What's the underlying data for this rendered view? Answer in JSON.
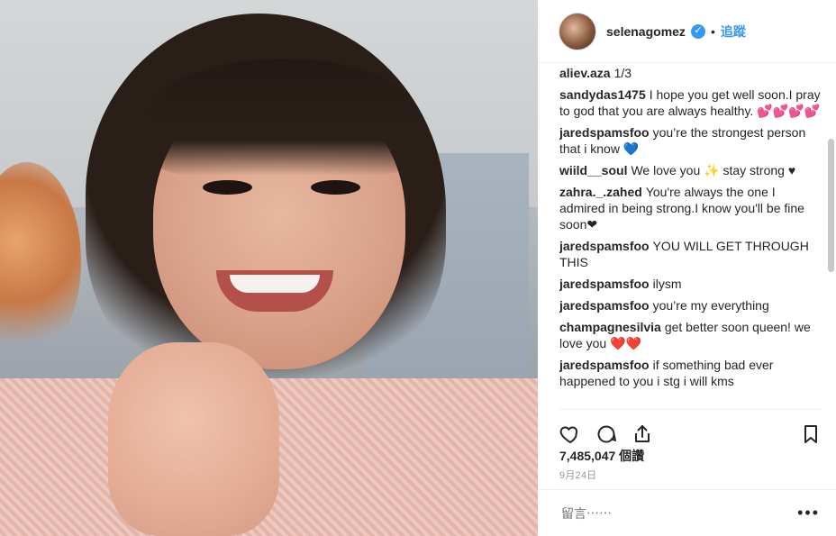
{
  "header": {
    "username": "selenagomez",
    "verified_symbol": "✓",
    "dot": "•",
    "follow_label": "追蹤"
  },
  "comments": [
    {
      "user": "aliev.aza",
      "text": "1/3"
    },
    {
      "user": "sandydas1475",
      "text": "I hope you get well soon.I pray to god that you are always healthy. 💕💕💕💕"
    },
    {
      "user": "jaredspamsfoo",
      "text": "you’re the strongest person that i know 💙"
    },
    {
      "user": "wiild__soul",
      "text": "We love you ✨ stay strong ♥"
    },
    {
      "user": "zahra._.zahed",
      "text": "You're always the one I admired in being strong.I know you'll be fine soon❤"
    },
    {
      "user": "jaredspamsfoo",
      "text": "YOU WILL GET THROUGH THIS"
    },
    {
      "user": "jaredspamsfoo",
      "text": "ilysm"
    },
    {
      "user": "jaredspamsfoo",
      "text": "you’re my everything"
    },
    {
      "user": "champagnesilvia",
      "text": "get better soon queen! we love you ❤️❤️"
    },
    {
      "user": "jaredspamsfoo",
      "text": "if something bad ever happened to you i stg i will kms"
    }
  ],
  "actions": {
    "like_icon": "heart-outline-icon",
    "comment_icon": "comment-bubble-icon",
    "share_icon": "share-upload-icon",
    "save_icon": "bookmark-outline-icon"
  },
  "meta": {
    "views": "7,485,047 個讚",
    "date": "9月24日"
  },
  "add_comment": {
    "placeholder": "留言⋯⋯",
    "more_label": "•••"
  }
}
